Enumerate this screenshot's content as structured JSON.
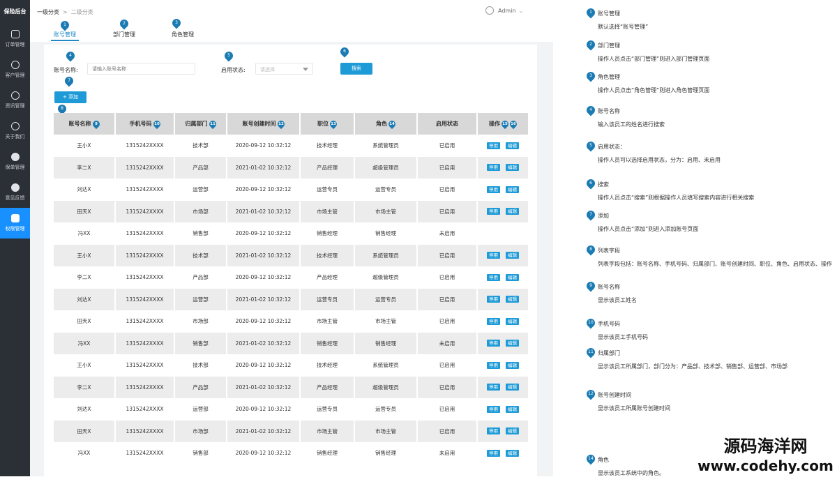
{
  "app": {
    "brand": "保险后台"
  },
  "sidebar": {
    "items": [
      {
        "label": "订单管理",
        "icon": "document-icon",
        "active": false
      },
      {
        "label": "客户管理",
        "icon": "user-icon",
        "active": false
      },
      {
        "label": "资讯管理",
        "icon": "globe-icon",
        "active": false
      },
      {
        "label": "关于我们",
        "icon": "info-icon",
        "active": false
      },
      {
        "label": "保单管理",
        "icon": "policy-icon",
        "active": false
      },
      {
        "label": "意见反馈",
        "icon": "feedback-icon",
        "active": false
      },
      {
        "label": "权限管理",
        "icon": "shield-icon",
        "active": true
      }
    ]
  },
  "breadcrumb": {
    "level1": "一级分类",
    "separator": ">",
    "level2": "二级分类"
  },
  "user": {
    "name": "Admin"
  },
  "tabs": [
    {
      "label": "账号管理",
      "marker": "1",
      "active": true
    },
    {
      "label": "部门管理",
      "marker": "2",
      "active": false
    },
    {
      "label": "角色管理",
      "marker": "3",
      "active": false
    }
  ],
  "filters": {
    "account_label": "账号名称:",
    "account_placeholder": "请输入账号名称",
    "status_label": "启用状态:",
    "status_placeholder": "请选择",
    "search_label": "搜索",
    "add_label": "添加",
    "markers": {
      "account": "4",
      "status": "5",
      "search": "6",
      "add": "7",
      "table": "8"
    }
  },
  "table": {
    "columns": [
      {
        "label": "账号名称",
        "marker": "9"
      },
      {
        "label": "手机号码",
        "marker": "10"
      },
      {
        "label": "归属部门",
        "marker": "11"
      },
      {
        "label": "账号创建时间",
        "marker": "12"
      },
      {
        "label": "职位",
        "marker": "13"
      },
      {
        "label": "角色",
        "marker": "14"
      },
      {
        "label": "启用状态",
        "marker": ""
      },
      {
        "label": "操作",
        "marker": ""
      }
    ],
    "op_markers": [
      "15",
      "16"
    ],
    "disable_label": "停用",
    "edit_label": "编辑",
    "rows": [
      {
        "name": "王小X",
        "phone": "1315242XXXX",
        "dept": "技术部",
        "created": "2020-09-12   10:32:12",
        "position": "技术经理",
        "role": "系统管理员",
        "status": "已启用",
        "ops": true
      },
      {
        "name": "李二X",
        "phone": "1315242XXXX",
        "dept": "产品部",
        "created": "2021-01-02   10:32:12",
        "position": "产品经理",
        "role": "超级管理员",
        "status": "已启用",
        "ops": true
      },
      {
        "name": "刘达X",
        "phone": "1315242XXXX",
        "dept": "运营部",
        "created": "2020-09-12   10:32:12",
        "position": "运营专员",
        "role": "运营专员",
        "status": "已启用",
        "ops": true
      },
      {
        "name": "田天X",
        "phone": "1315242XXXX",
        "dept": "市场部",
        "created": "2021-01-02   10:32:12",
        "position": "市场主管",
        "role": "市场主管",
        "status": "已启用",
        "ops": true
      },
      {
        "name": "冯XX",
        "phone": "1315242XXXX",
        "dept": "销售部",
        "created": "2020-09-12   10:32:12",
        "position": "销售经理",
        "role": "销售经理",
        "status": "未启用",
        "ops": false
      },
      {
        "name": "王小X",
        "phone": "1315242XXXX",
        "dept": "技术部",
        "created": "2021-01-02   10:32:12",
        "position": "技术经理",
        "role": "系统管理员",
        "status": "已启用",
        "ops": true
      },
      {
        "name": "李二X",
        "phone": "1315242XXXX",
        "dept": "产品部",
        "created": "2020-09-12   10:32:12",
        "position": "产品经理",
        "role": "超级管理员",
        "status": "已启用",
        "ops": true
      },
      {
        "name": "刘达X",
        "phone": "1315242XXXX",
        "dept": "运营部",
        "created": "2021-01-02   10:32:12",
        "position": "运营专员",
        "role": "运营专员",
        "status": "已启用",
        "ops": true
      },
      {
        "name": "田天X",
        "phone": "1315242XXXX",
        "dept": "市场部",
        "created": "2020-09-12   10:32:12",
        "position": "市场主管",
        "role": "市场主管",
        "status": "已启用",
        "ops": true
      },
      {
        "name": "冯XX",
        "phone": "1315242XXXX",
        "dept": "销售部",
        "created": "2021-01-02   10:32:12",
        "position": "销售经理",
        "role": "销售经理",
        "status": "未启用",
        "ops": true
      },
      {
        "name": "王小X",
        "phone": "1315242XXXX",
        "dept": "技术部",
        "created": "2020-09-12   10:32:12",
        "position": "技术经理",
        "role": "系统管理员",
        "status": "已启用",
        "ops": true
      },
      {
        "name": "李二X",
        "phone": "1315242XXXX",
        "dept": "产品部",
        "created": "2021-01-02   10:32:12",
        "position": "产品经理",
        "role": "超级管理员",
        "status": "已启用",
        "ops": true
      },
      {
        "name": "刘达X",
        "phone": "1315242XXXX",
        "dept": "运营部",
        "created": "2020-09-12   10:32:12",
        "position": "运营专员",
        "role": "运营专员",
        "status": "已启用",
        "ops": true
      },
      {
        "name": "田天X",
        "phone": "1315242XXXX",
        "dept": "市场部",
        "created": "2021-01-02   10:32:12",
        "position": "市场主管",
        "role": "市场主管",
        "status": "已启用",
        "ops": true
      },
      {
        "name": "冯XX",
        "phone": "1315242XXXX",
        "dept": "销售部",
        "created": "2020-09-12   10:32:12",
        "position": "销售经理",
        "role": "销售经理",
        "status": "未启用",
        "ops": true
      }
    ]
  },
  "notes": [
    {
      "marker": "1",
      "title": "账号管理",
      "desc": "默认选择“账号管理”"
    },
    {
      "marker": "2",
      "title": "部门管理",
      "desc": "操作人员点击“部门管理”则进入部门管理页面"
    },
    {
      "marker": "3",
      "title": "角色管理",
      "desc": "操作人员点击“角色管理”则进入角色管理页面"
    },
    {
      "marker": "4",
      "title": "账号名称",
      "desc": "输入该员工的姓名进行搜索"
    },
    {
      "marker": "5",
      "title": "启用状态：",
      "desc": "操作人员可以选择启用状态，分为：启用、未启用"
    },
    {
      "marker": "6",
      "title": "搜索",
      "desc": "操作人员点击“搜索”则根据操作人员填写搜索内容进行相关搜索"
    },
    {
      "marker": "7",
      "title": "添加",
      "desc": "操作人员点击“添加”则进入添加账号页面"
    },
    {
      "marker": "8",
      "title": "列表字段",
      "desc": "列表字段包括：账号名称、手机号码、归属部门、账号创建时间、职位、角色、启用状态、操作"
    },
    {
      "marker": "9",
      "title": "账号名称",
      "desc": "显示该员工姓名"
    },
    {
      "marker": "10",
      "title": "手机号码",
      "desc": "显示该员工手机号码"
    },
    {
      "marker": "11",
      "title": "归属部门",
      "desc": "显示该员工所属部门，部门分为：产品部、技术部、销售部、运营部、市场部"
    },
    {
      "marker": "12",
      "title": "账号创建时间",
      "desc": "显示该员工所属账号创建时间"
    },
    {
      "marker": "14",
      "title": "角色",
      "desc": "显示该员工系统中的角色。"
    }
  ],
  "watermark": {
    "cn": "源码海洋网",
    "url": "www.codehy.com"
  }
}
